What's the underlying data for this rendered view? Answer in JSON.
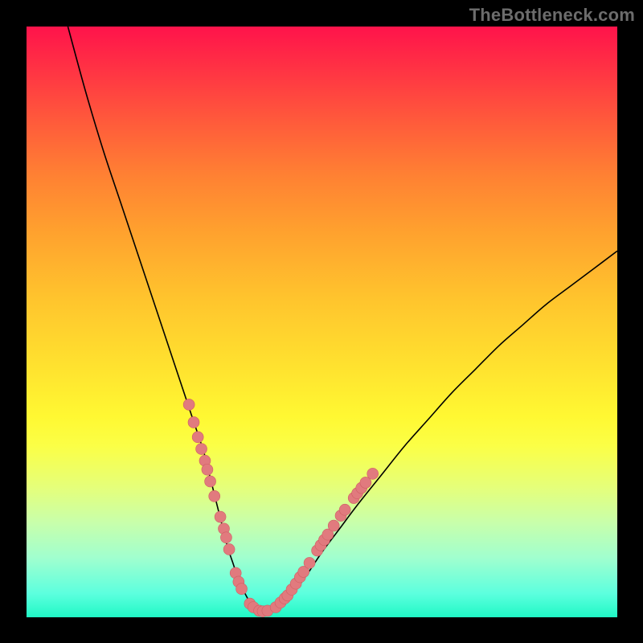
{
  "watermark": "TheBottleneck.com",
  "colors": {
    "curve": "#000000",
    "marker_fill": "#e17a7e",
    "marker_stroke": "#cf5f64",
    "gradient_top": "#ff134b",
    "gradient_bottom": "#20f8c5"
  },
  "chart_data": {
    "type": "line",
    "title": "",
    "xlabel": "",
    "ylabel": "",
    "xlim": [
      0,
      100
    ],
    "ylim": [
      0,
      100
    ],
    "grid": false,
    "series": [
      {
        "name": "curve",
        "x": [
          7,
          10,
          13,
          16,
          19,
          22,
          24,
          26,
          28,
          30,
          31,
          32,
          33,
          34,
          35,
          36,
          37,
          38,
          39,
          40,
          42,
          44,
          46,
          48,
          50,
          53,
          56,
          60,
          64,
          68,
          72,
          76,
          80,
          84,
          88,
          92,
          96,
          100
        ],
        "y": [
          100,
          89,
          79,
          70,
          61,
          52,
          46,
          40,
          34,
          28,
          24,
          20,
          16,
          12,
          9,
          6,
          4,
          2.2,
          1.2,
          1,
          1.5,
          3,
          5.2,
          8,
          11,
          15,
          19,
          24,
          29,
          33.5,
          38,
          42,
          46,
          49.5,
          53,
          56,
          59,
          62
        ]
      }
    ],
    "markers": {
      "name": "highlight-points",
      "points": [
        {
          "x": 27.5,
          "y": 36
        },
        {
          "x": 28.3,
          "y": 33
        },
        {
          "x": 29.0,
          "y": 30.5
        },
        {
          "x": 29.6,
          "y": 28.5
        },
        {
          "x": 30.2,
          "y": 26.5
        },
        {
          "x": 30.6,
          "y": 25
        },
        {
          "x": 31.1,
          "y": 23
        },
        {
          "x": 31.8,
          "y": 20.5
        },
        {
          "x": 32.8,
          "y": 17
        },
        {
          "x": 33.4,
          "y": 15
        },
        {
          "x": 33.8,
          "y": 13.5
        },
        {
          "x": 34.3,
          "y": 11.5
        },
        {
          "x": 35.4,
          "y": 7.5
        },
        {
          "x": 35.9,
          "y": 6
        },
        {
          "x": 36.4,
          "y": 4.8
        },
        {
          "x": 37.8,
          "y": 2.3
        },
        {
          "x": 38.4,
          "y": 1.7
        },
        {
          "x": 39.4,
          "y": 1.1
        },
        {
          "x": 40.0,
          "y": 1.0
        },
        {
          "x": 40.8,
          "y": 1.1
        },
        {
          "x": 42.2,
          "y": 1.7
        },
        {
          "x": 43.0,
          "y": 2.5
        },
        {
          "x": 43.7,
          "y": 3.2
        },
        {
          "x": 44.2,
          "y": 3.7
        },
        {
          "x": 44.9,
          "y": 4.7
        },
        {
          "x": 45.6,
          "y": 5.7
        },
        {
          "x": 46.3,
          "y": 6.8
        },
        {
          "x": 46.9,
          "y": 7.7
        },
        {
          "x": 47.9,
          "y": 9.2
        },
        {
          "x": 49.2,
          "y": 11.3
        },
        {
          "x": 49.8,
          "y": 12.2
        },
        {
          "x": 50.4,
          "y": 13.1
        },
        {
          "x": 51.0,
          "y": 14.0
        },
        {
          "x": 52.0,
          "y": 15.5
        },
        {
          "x": 53.2,
          "y": 17.2
        },
        {
          "x": 53.9,
          "y": 18.2
        },
        {
          "x": 55.4,
          "y": 20.2
        },
        {
          "x": 56.0,
          "y": 21.0
        },
        {
          "x": 56.7,
          "y": 21.9
        },
        {
          "x": 57.4,
          "y": 22.8
        },
        {
          "x": 58.6,
          "y": 24.3
        }
      ],
      "radius_px": 7
    }
  }
}
